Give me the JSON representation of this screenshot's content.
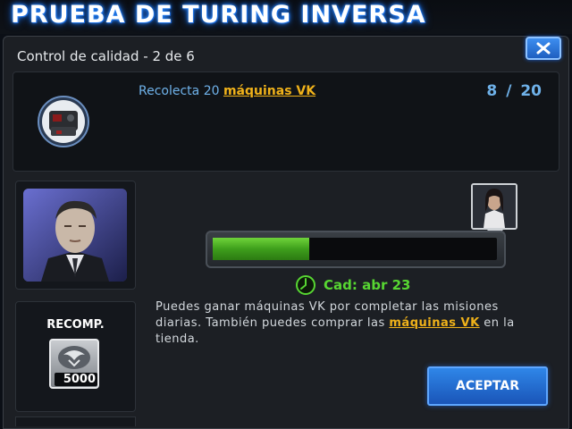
{
  "header": {
    "title": "PRUEBA DE TURING INVERSA"
  },
  "dialog": {
    "subtitle": "Control de calidad - 2 de 6",
    "close_icon": "close-x-icon"
  },
  "objective": {
    "prefix": "Recolecta 20 ",
    "link": "máquinas VK",
    "current": "8",
    "separator": "/",
    "total": "20",
    "icon": "vk-machine-icon"
  },
  "reward": {
    "label": "RECOMP.",
    "amount": "5000",
    "icon": "shield-emblem-icon"
  },
  "progress": {
    "fraction": 0.34,
    "fill_color": "#4fb025"
  },
  "deadline": {
    "text": "Cad: abr 23",
    "icon": "clock-icon"
  },
  "description": {
    "part1": "Puedes ganar máquinas VK por completar las misiones diarias. También puedes comprar las ",
    "link": "máquinas VK",
    "part2": " en la tienda."
  },
  "actions": {
    "accept_label": "ACEPTAR"
  }
}
